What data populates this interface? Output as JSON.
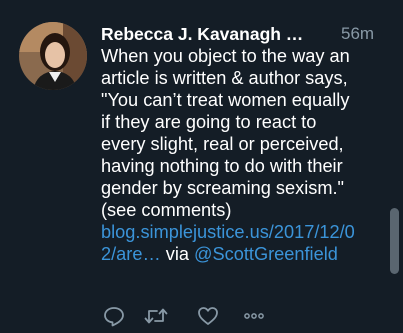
{
  "tweet": {
    "author_name": "Rebecca J. Kavanagh …",
    "time": "56m",
    "text_lines": [
      "When you object to the way an",
      "article is written & author says,",
      "\"You can’t treat women equally",
      "if they are going to react to",
      "every slight, real or perceived,",
      "having nothing to do with their",
      "gender by screaming sexism.\"",
      "(see comments)"
    ],
    "link_line1": "blog.simplejustice.us/2017/12/0",
    "link_line2": "2/are…",
    "via_text": "via",
    "mention": "@ScottGreenfield"
  },
  "actions": {
    "reply_icon": "reply-icon",
    "retweet_icon": "retweet-icon",
    "like_icon": "heart-icon",
    "more_icon": "more-icon"
  },
  "colors": {
    "background": "#141d26",
    "text": "#ffffff",
    "muted": "#8899a6",
    "link": "#3b94d9"
  }
}
